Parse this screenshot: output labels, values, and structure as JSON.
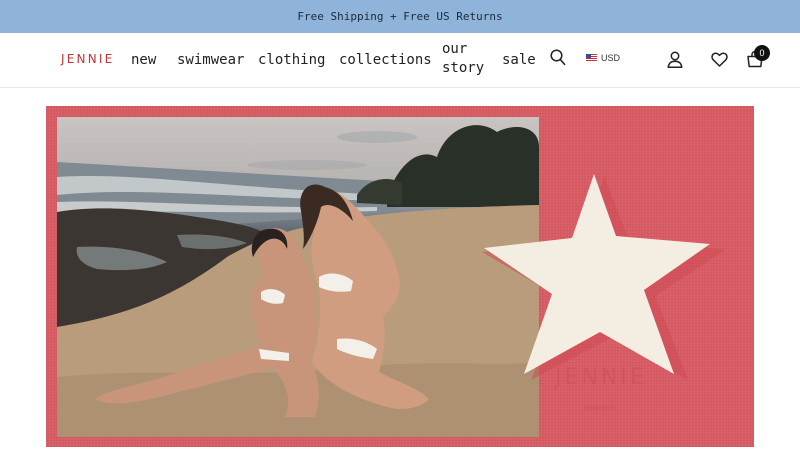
{
  "announcement": {
    "text": "Free Shipping + Free US Returns"
  },
  "header": {
    "logo": "JENNIE",
    "nav": [
      "new",
      "swimwear",
      "clothing",
      "collections",
      "our story",
      "sale"
    ],
    "currency": "USD",
    "cart_count": "0",
    "icons": [
      "search-icon",
      "us-flag-icon",
      "account-icon",
      "wishlist-icon",
      "cart-icon"
    ]
  },
  "hero": {
    "brand": "JENNIE",
    "subtitle": "now live"
  },
  "colors": {
    "announcement_bg": "#8fb3d9",
    "brand_red": "#c8323c",
    "hero_bg": "#d95c64",
    "star_fill": "#f4ede2"
  }
}
